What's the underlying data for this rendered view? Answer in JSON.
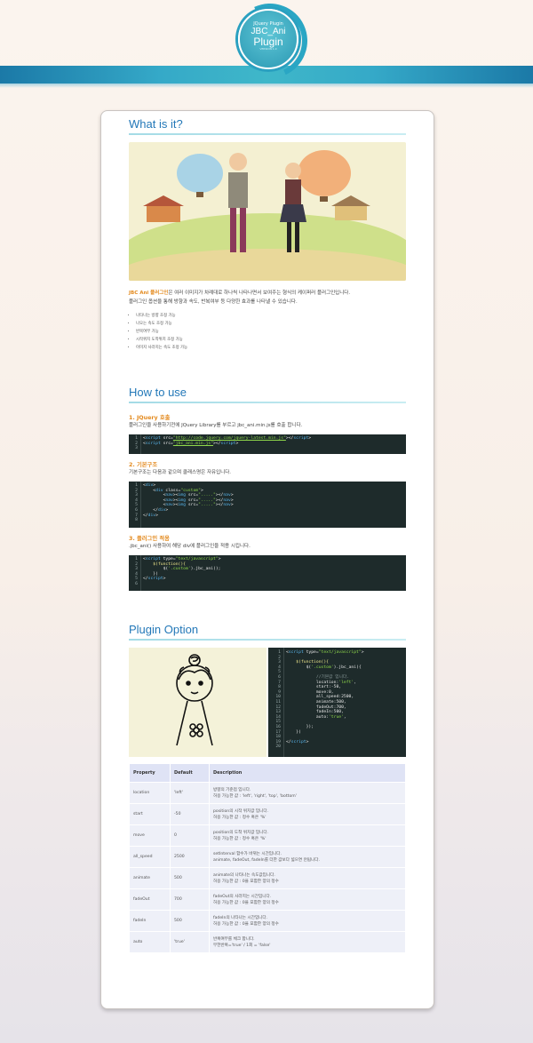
{
  "header": {
    "badge_line1": "JQuery Plugin",
    "badge_line2": "JBC_Ani",
    "badge_line3": "Plugin",
    "badge_version": "VERSION 1.0",
    "colors": {
      "bar": "#2a98b8",
      "accent": "#e38a1e",
      "heading": "#2378b8"
    }
  },
  "what": {
    "title": "What is it?",
    "name": "JBC Ani 플러그인",
    "desc1": "은 여러 이미지가 차례대로 하나씩 나타나면서 보여주는 형식의 케이퍼러 플러그인입니다.",
    "desc2": "플러그인 옵션을 통해 방향과 속도, 반복여부 등 다양한 효과를 나타낼 수 있습니다.",
    "features": [
      "나타나는 방향 조정 가능",
      "나오는 속도 조정 가능",
      "반복여부 가능",
      "시작위치 도착위치 조정 가능",
      "이미지 사라지는 속도 조정 가능"
    ]
  },
  "how": {
    "title": "How to use",
    "step1_title": "1. JQuery 호출",
    "step1_desc": "플러그인을 사용하기전에 JQuery Library를 부르고 jbc_ani.min.js를 호출 합니다.",
    "step2_title": "2. 기본구조",
    "step2_desc": "기본구조는 다음과 같으며 클래스명은 자유입니다.",
    "step3_title": "3. 플러그인 적용",
    "step3_desc": ".jbc_ani() 사용하여 해당 div에 플러그인을 적용 시킵니다."
  },
  "option": {
    "title": "Plugin Option",
    "table_headers": [
      "Property",
      "Default",
      "Description"
    ],
    "rows": [
      {
        "property": "location",
        "default": "'left'",
        "desc1": "방향의 기준점 입니다.",
        "desc2": "허용 가능한 값 : 'left', 'right', 'top', 'bottom'"
      },
      {
        "property": "start",
        "default": "-50",
        "desc1": "position의 시작 위치값 입니다.",
        "desc2": "허용 가능한 값 : 정수 혹은 '%'"
      },
      {
        "property": "move",
        "default": "0",
        "desc1": "position의 도착 위치값 입니다.",
        "desc2": "허용 가능한 값 : 정수 혹은 '%'"
      },
      {
        "property": "all_speed",
        "default": "2500",
        "desc1": "setInterval 함수가 바뀌는 시간입니다.",
        "desc2": "animate, fadeOut, fadeIn를 더한 값보다 넓으면 안됩니다."
      },
      {
        "property": "animate",
        "default": "500",
        "desc1": "animate의 나타나는 속도값입니다.",
        "desc2": "허용 가능한 값 : 0을 포함한 양의 정수"
      },
      {
        "property": "fadeOut",
        "default": "700",
        "desc1": "fadeOut의 사라지는 시간입니다.",
        "desc2": "허용 가능한 값 : 0을 포함한 양의 정수"
      },
      {
        "property": "fadeIn",
        "default": "500",
        "desc1": "fadeIn의 나타나는 시간입니다.",
        "desc2": "허용 가능한 값 : 0을 포함한 양의 정수"
      },
      {
        "property": "auto",
        "default": "'true'",
        "desc1": "반복여부를 체크 합니다.",
        "desc2": "무한반복='true' / 1회 = 'false'"
      }
    ]
  }
}
